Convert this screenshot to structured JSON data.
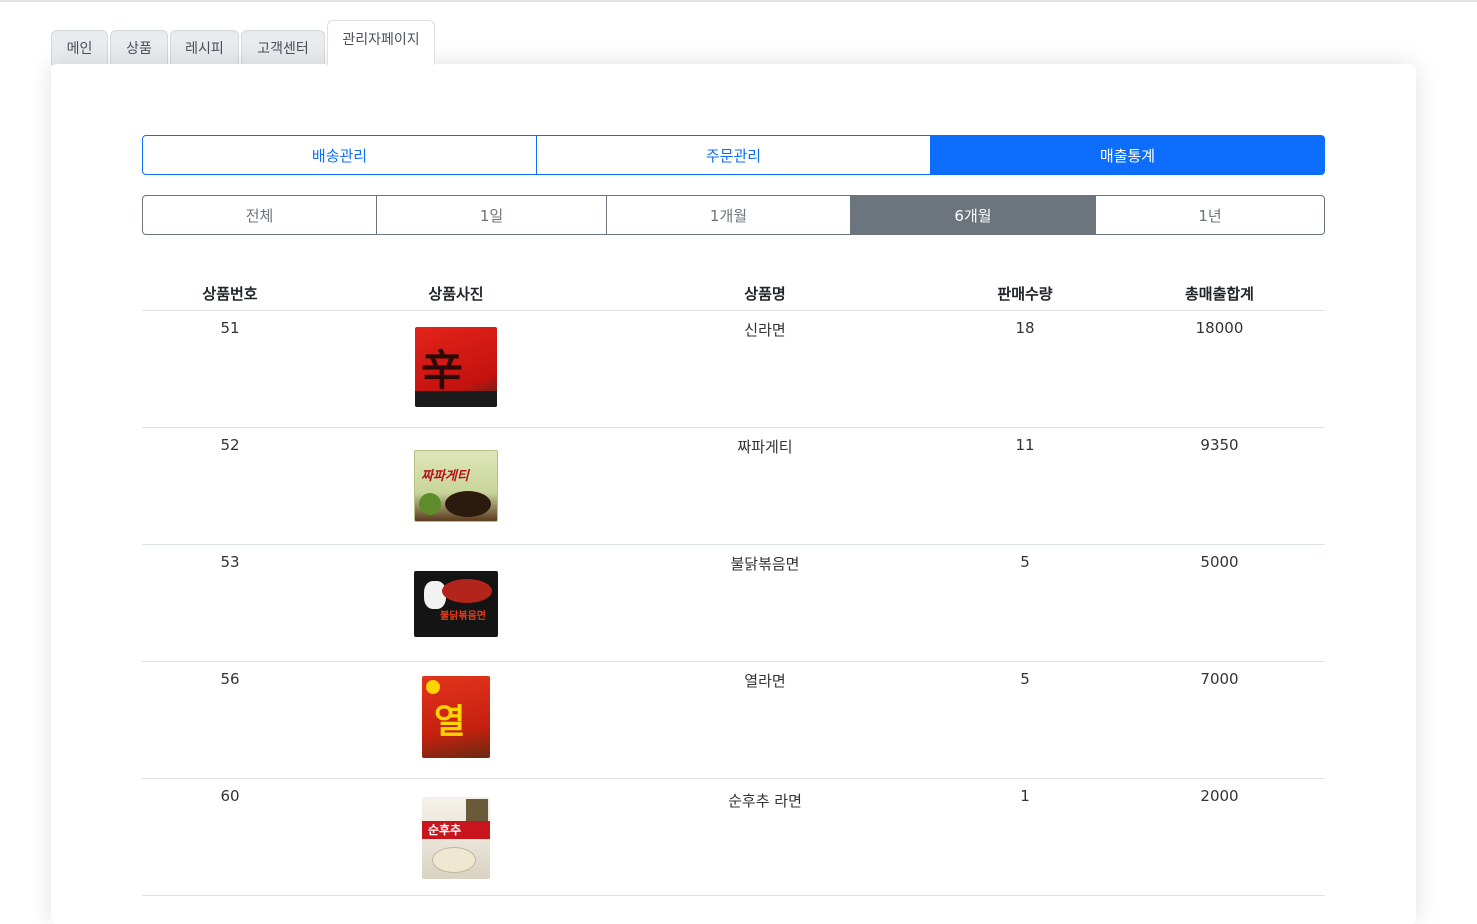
{
  "tabs": [
    {
      "label": "메인"
    },
    {
      "label": "상품"
    },
    {
      "label": "레시피"
    },
    {
      "label": "고객센터"
    },
    {
      "label": "관리자페이지"
    }
  ],
  "admin_menu": [
    {
      "label": "배송관리"
    },
    {
      "label": "주문관리"
    },
    {
      "label": "매출통계"
    }
  ],
  "period_filter": [
    {
      "label": "전체"
    },
    {
      "label": "1일"
    },
    {
      "label": "1개월"
    },
    {
      "label": "6개월"
    },
    {
      "label": "1년"
    }
  ],
  "table": {
    "headers": [
      "상품번호",
      "상품사진",
      "상품명",
      "판매수량",
      "총매출합계"
    ],
    "rows": [
      {
        "id": "51",
        "name": "신라면",
        "qty": "18",
        "total": "18000",
        "image_label": "辛"
      },
      {
        "id": "52",
        "name": "짜파게티",
        "qty": "11",
        "total": "9350",
        "image_label": "짜파게티"
      },
      {
        "id": "53",
        "name": "불닭볶음면",
        "qty": "5",
        "total": "5000",
        "image_label": "불닭볶음면"
      },
      {
        "id": "56",
        "name": "열라면",
        "qty": "5",
        "total": "7000",
        "image_label": "열"
      },
      {
        "id": "60",
        "name": "순후추 라면",
        "qty": "1",
        "total": "2000",
        "image_label": "순후추"
      }
    ]
  },
  "colors": {
    "primary": "#0d6efd",
    "secondary": "#6c757d"
  }
}
